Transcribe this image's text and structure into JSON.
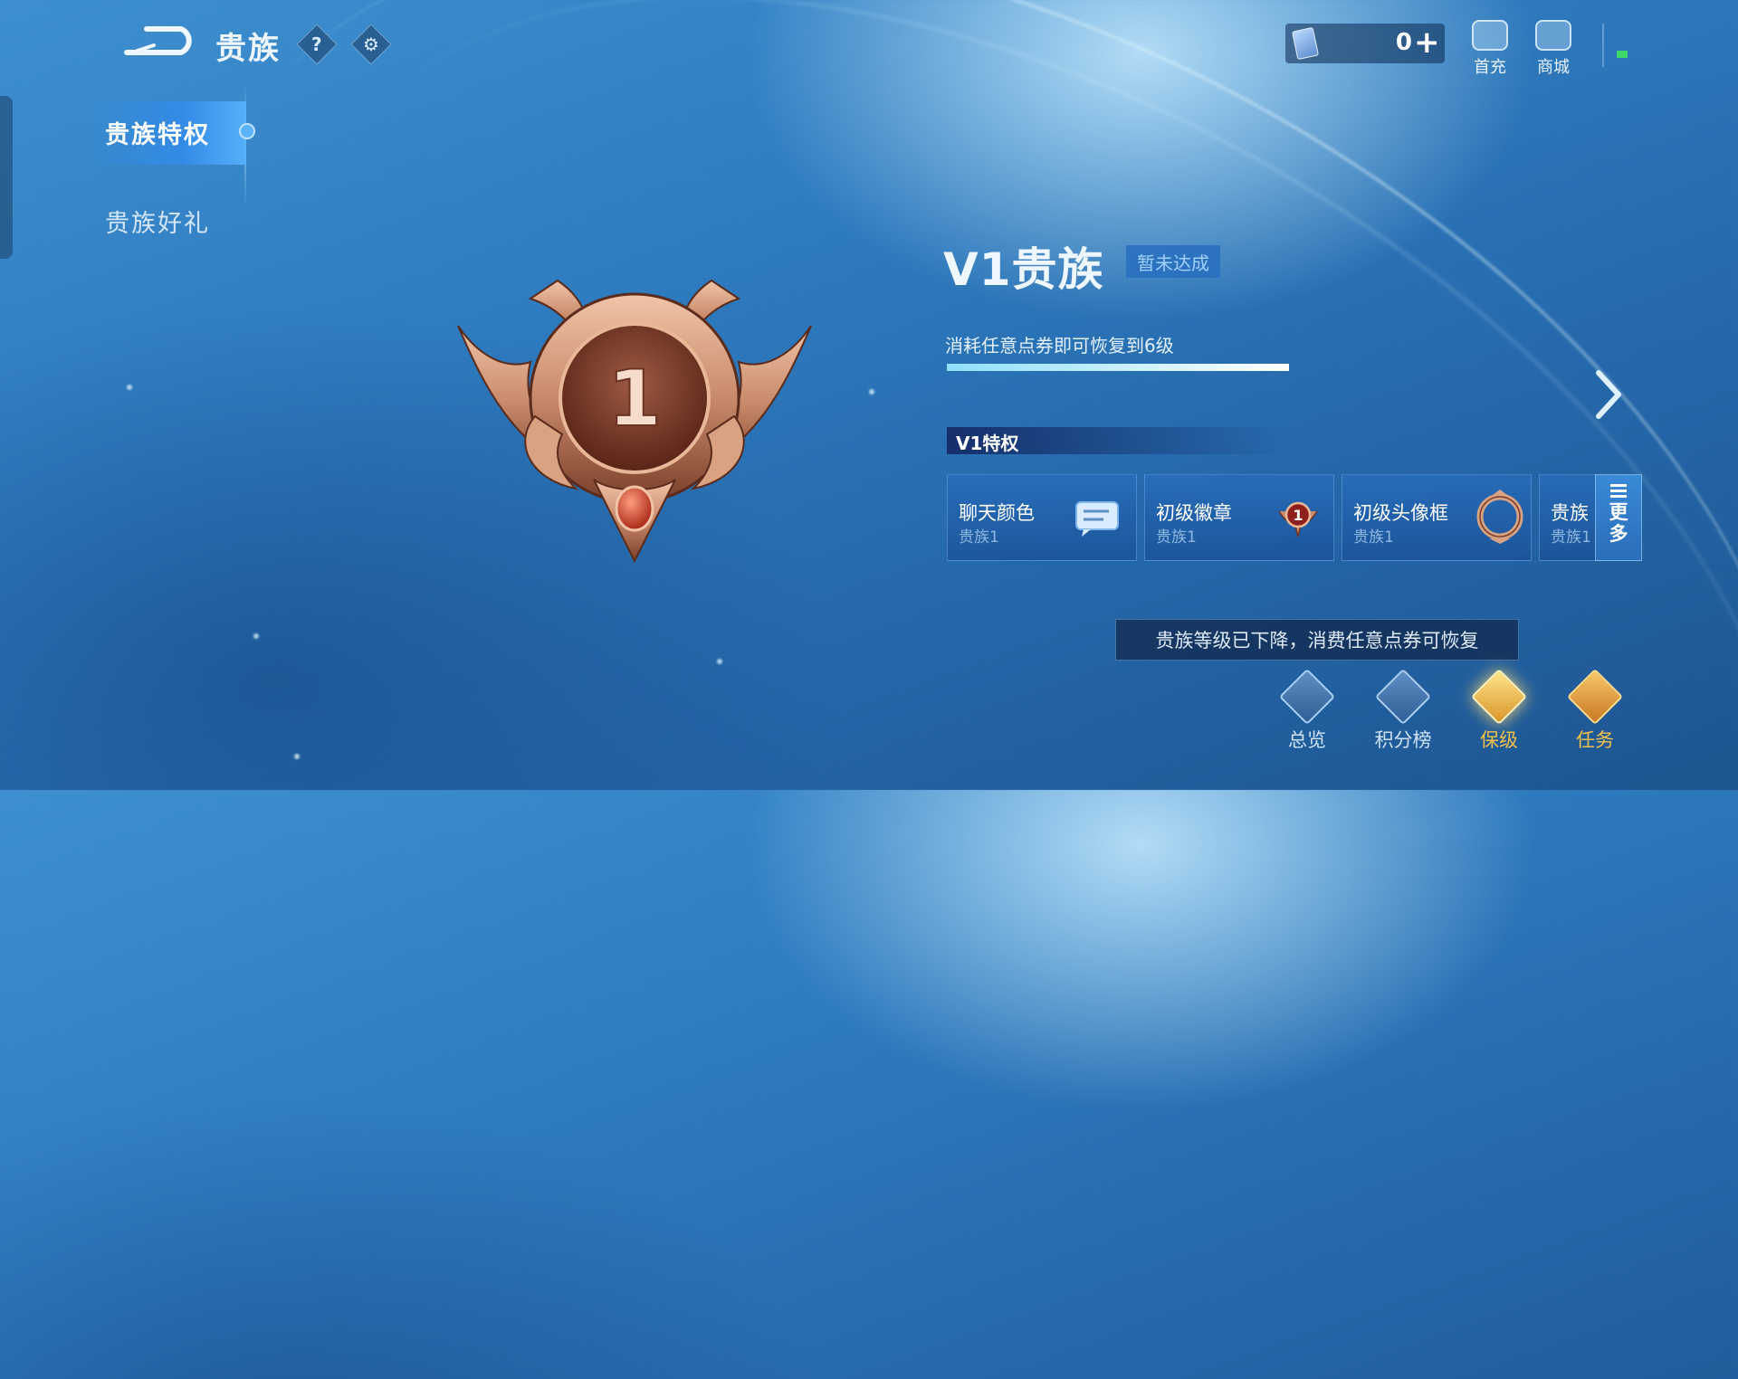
{
  "header": {
    "title": "贵族",
    "help_icon": "question-icon",
    "settings_icon": "gear-icon"
  },
  "currency": {
    "icon": "voucher-icon",
    "value": "0",
    "add_icon": "plus-icon"
  },
  "top_shortcuts": [
    {
      "label": "首充",
      "icon": "first-recharge-icon"
    },
    {
      "label": "商城",
      "icon": "shop-icon"
    }
  ],
  "sidebar": {
    "items": [
      {
        "label": "贵族特权",
        "active": true
      },
      {
        "label": "贵族好礼",
        "active": false
      }
    ]
  },
  "emblem": {
    "level_number": "1",
    "color_primary": "#c88a6a",
    "gem_color": "#c8331f"
  },
  "level": {
    "title": "V1贵族",
    "status": "暂未达成",
    "hint": "消耗任意点券即可恢复到6级",
    "progress_fraction": 1.0
  },
  "privileges": {
    "header": "V1特权",
    "cards": [
      {
        "name": "聊天颜色",
        "sub": "贵族1",
        "icon": "chat-bubble-icon"
      },
      {
        "name": "初级徽章",
        "sub": "贵族1",
        "icon": "badge-icon"
      },
      {
        "name": "初级头像框",
        "sub": "贵族1",
        "icon": "avatar-frame-icon"
      },
      {
        "name": "贵族",
        "sub": "贵族1",
        "icon": ""
      }
    ],
    "more_label": "更多"
  },
  "tooltip": "贵族等级已下降，消费任意点券可恢复",
  "bottom_tabs": [
    {
      "label": "总览",
      "icon": "overview-icon",
      "color": "#cfe2f7"
    },
    {
      "label": "积分榜",
      "icon": "leaderboard-icon",
      "color": "#cfe2f7"
    },
    {
      "label": "保级",
      "icon": "keep-level-icon",
      "color": "#f2c04a"
    },
    {
      "label": "任务",
      "icon": "task-icon",
      "color": "#f2c04a"
    }
  ]
}
